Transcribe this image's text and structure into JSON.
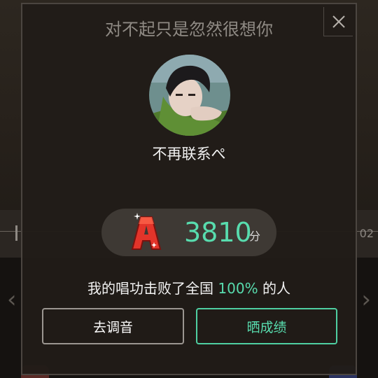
{
  "background": {
    "time_label": "02"
  },
  "dialog": {
    "song_title": "对不起只是忽然很想你",
    "close_icon": "close-icon",
    "username": "不再联系ぺ",
    "score": {
      "grade": "A",
      "value": "3810",
      "unit": "分"
    },
    "result": {
      "prefix": "我的唱功击败了全国",
      "percent": "100%",
      "suffix": "的人"
    },
    "buttons": {
      "tune_label": "去调音",
      "share_label": "晒成绩"
    }
  },
  "colors": {
    "accent": "#58dcae",
    "grade_red": "#e3342a"
  }
}
